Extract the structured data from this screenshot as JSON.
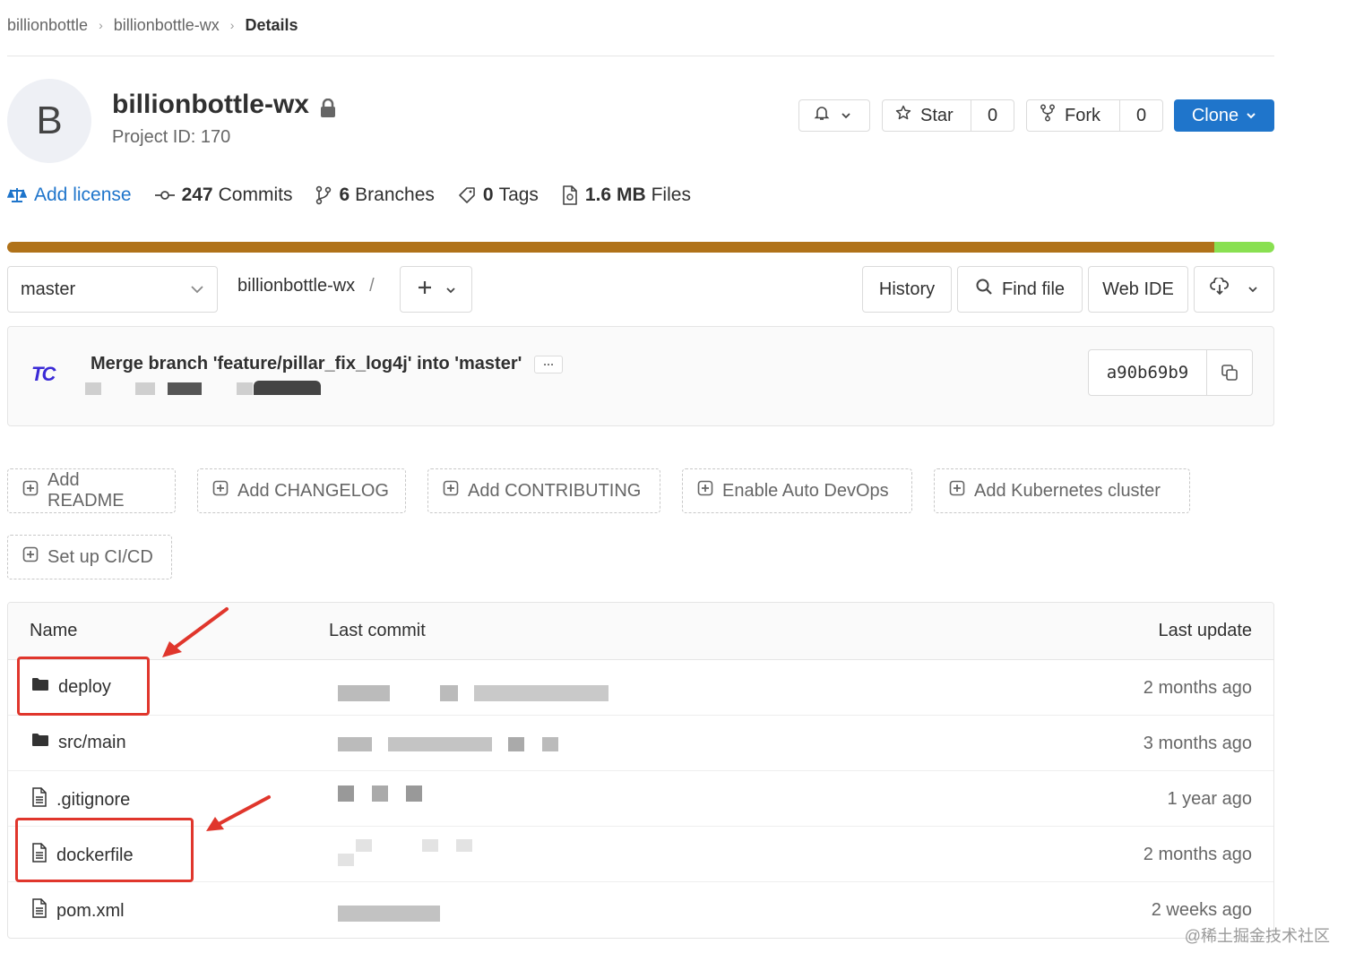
{
  "breadcrumb": [
    "billionbottle",
    "billionbottle-wx",
    "Details"
  ],
  "project": {
    "avatar_letter": "B",
    "name": "billionbottle-wx",
    "id_text": "Project ID: 170"
  },
  "header_actions": {
    "star_label": "Star",
    "star_count": "0",
    "fork_label": "Fork",
    "fork_count": "0",
    "clone_label": "Clone"
  },
  "stats": {
    "add_license": "Add license",
    "commits_count": "247",
    "commits_label": "Commits",
    "branches_count": "6",
    "branches_label": "Branches",
    "tags_count": "0",
    "tags_label": "Tags",
    "files_size": "1.6 MB",
    "files_label": "Files"
  },
  "language_colors": {
    "primary": "#b07219",
    "secondary": "#89e051"
  },
  "tree": {
    "branch": "master",
    "path": "billionbottle-wx",
    "path_separator": "/",
    "history": "History",
    "find_file": "Find file",
    "web_ide": "Web IDE"
  },
  "last_commit": {
    "logo_text": "TC",
    "message": "Merge branch 'feature/pillar_fix_log4j' into 'master'",
    "more": "···",
    "sha": "a90b69b9"
  },
  "actions": [
    "Add README",
    "Add CHANGELOG",
    "Add CONTRIBUTING",
    "Enable Auto DevOps",
    "Add Kubernetes cluster",
    "Set up CI/CD"
  ],
  "files": {
    "headers": {
      "name": "Name",
      "last_commit": "Last commit",
      "last_update": "Last update"
    },
    "rows": [
      {
        "name": "deploy",
        "type": "folder",
        "updated": "2 months ago"
      },
      {
        "name": "src/main",
        "type": "folder",
        "updated": "3 months ago"
      },
      {
        "name": ".gitignore",
        "type": "file",
        "updated": "1 year ago"
      },
      {
        "name": "dockerfile",
        "type": "file",
        "updated": "2 months ago"
      },
      {
        "name": "pom.xml",
        "type": "file",
        "updated": "2 weeks ago"
      }
    ]
  },
  "watermark": "@稀土掘金技术社区",
  "accent_color": "#1f75cb",
  "highlight_color": "#e0362c"
}
